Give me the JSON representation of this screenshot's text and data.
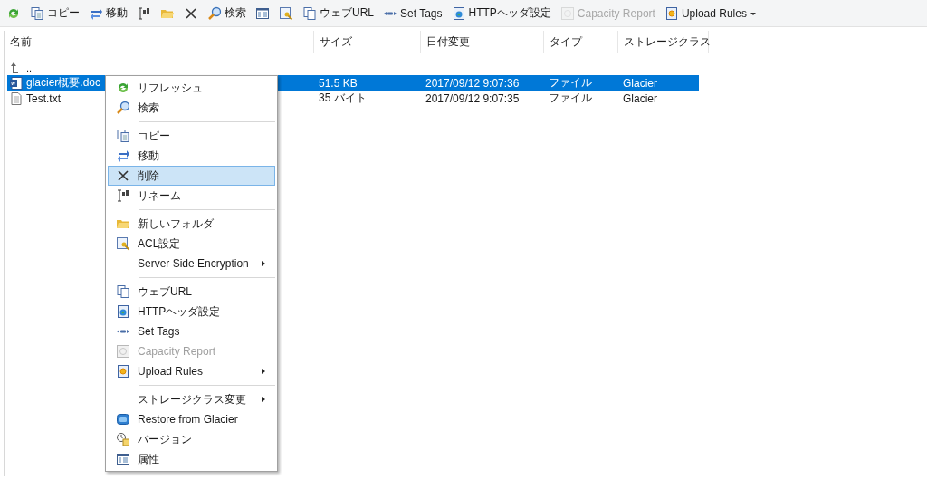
{
  "toolbar": [
    {
      "disabled": false
    },
    {
      "label": "コピー",
      "disabled": false
    },
    {
      "label": "移動",
      "disabled": false
    },
    {
      "disabled": false
    },
    {
      "disabled": false
    },
    {
      "disabled": false
    },
    {
      "label": "検索",
      "disabled": false
    },
    {
      "disabled": false
    },
    {
      "disabled": false
    },
    {
      "label": "ウェブURL",
      "disabled": false
    },
    {
      "label": "Set Tags",
      "disabled": false
    },
    {
      "label": "HTTPヘッダ設定",
      "disabled": false
    },
    {
      "label": "Capacity Report",
      "disabled": true
    },
    {
      "label": "Upload Rules",
      "disabled": false,
      "dropdown": true
    }
  ],
  "table": {
    "columns": [
      "名前",
      "サイズ",
      "日付変更",
      "タイプ",
      "ストレージクラス"
    ],
    "parent_row": {
      "name": ".."
    },
    "rows": [
      {
        "name": "glacier概要.doc",
        "size": "51.5 KB",
        "modified": "2017/09/12 9:07:36",
        "type": "ファイル",
        "storage_class": "Glacier",
        "selected": true
      },
      {
        "name": "Test.txt",
        "size": "35 バイト",
        "modified": "2017/09/12 9:07:35",
        "type": "ファイル",
        "storage_class": "Glacier",
        "selected": false
      }
    ]
  },
  "context_menu": [
    {
      "kind": "item",
      "label": "リフレッシュ",
      "disabled": false,
      "submenu": false,
      "selected": false
    },
    {
      "kind": "item",
      "label": "検索",
      "disabled": false,
      "submenu": false,
      "selected": false
    },
    {
      "kind": "separator"
    },
    {
      "kind": "item",
      "label": "コピー",
      "disabled": false,
      "submenu": false,
      "selected": false
    },
    {
      "kind": "item",
      "label": "移動",
      "disabled": false,
      "submenu": false,
      "selected": false
    },
    {
      "kind": "item",
      "label": "削除",
      "disabled": false,
      "submenu": false,
      "selected": true
    },
    {
      "kind": "item",
      "label": "リネーム",
      "disabled": false,
      "submenu": false,
      "selected": false
    },
    {
      "kind": "separator"
    },
    {
      "kind": "item",
      "label": "新しいフォルダ",
      "disabled": false,
      "submenu": false,
      "selected": false
    },
    {
      "kind": "item",
      "label": "ACL設定",
      "disabled": false,
      "submenu": false,
      "selected": false
    },
    {
      "kind": "item",
      "label": "Server Side Encryption",
      "disabled": false,
      "submenu": true,
      "selected": false
    },
    {
      "kind": "separator"
    },
    {
      "kind": "item",
      "label": "ウェブURL",
      "disabled": false,
      "submenu": false,
      "selected": false
    },
    {
      "kind": "item",
      "label": "HTTPヘッダ設定",
      "disabled": false,
      "submenu": false,
      "selected": false
    },
    {
      "kind": "item",
      "label": "Set Tags",
      "disabled": false,
      "submenu": false,
      "selected": false
    },
    {
      "kind": "item",
      "label": "Capacity Report",
      "disabled": true,
      "submenu": false,
      "selected": false
    },
    {
      "kind": "item",
      "label": "Upload Rules",
      "disabled": false,
      "submenu": true,
      "selected": false
    },
    {
      "kind": "separator"
    },
    {
      "kind": "item",
      "label": "ストレージクラス変更",
      "disabled": false,
      "submenu": true,
      "selected": false
    },
    {
      "kind": "item",
      "label": "Restore from Glacier",
      "disabled": false,
      "submenu": false,
      "selected": false
    },
    {
      "kind": "item",
      "label": "バージョン",
      "disabled": false,
      "submenu": false,
      "selected": false
    },
    {
      "kind": "item",
      "label": "属性",
      "disabled": false,
      "submenu": false,
      "selected": false
    }
  ]
}
